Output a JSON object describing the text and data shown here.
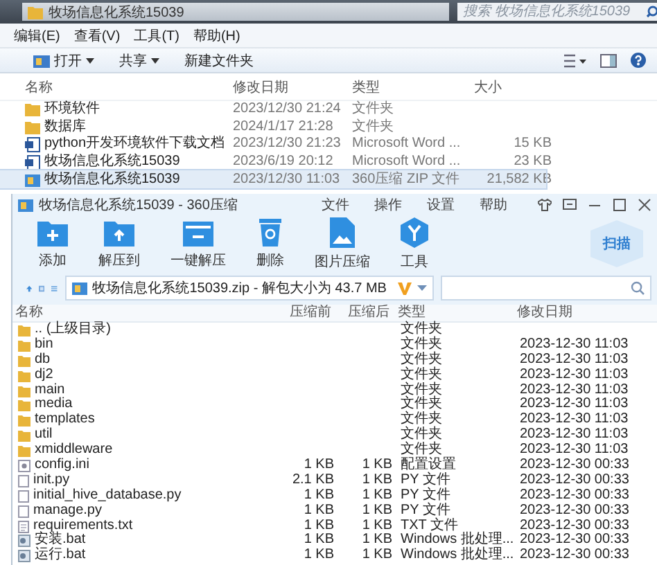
{
  "explorer": {
    "path": "牧场信息化系统15039",
    "search": {
      "placeholder": "搜索 牧场信息化系统15039"
    },
    "menu": [
      "编辑(E)",
      "查看(V)",
      "工具(T)",
      "帮助(H)"
    ],
    "toolbar": [
      {
        "label": "打开",
        "kind": "open"
      },
      {
        "label": "共享",
        "kind": "share"
      },
      {
        "label": "新建文件夹",
        "kind": "plain"
      }
    ],
    "columns": [
      "名称",
      "修改日期",
      "类型",
      "大小"
    ],
    "rows": [
      {
        "name": "环境软件",
        "date": "2023/12/30 21:24",
        "type": "文件夹",
        "size": "",
        "kind": "folder",
        "selected": false
      },
      {
        "name": "数据库",
        "date": "2024/1/17 21:28",
        "type": "文件夹",
        "size": "",
        "kind": "folder",
        "selected": false
      },
      {
        "name": "python开发环境软件下载文档",
        "date": "2023/12/30 21:23",
        "type": "Microsoft Word ...",
        "size": "15 KB",
        "kind": "word",
        "selected": false
      },
      {
        "name": "牧场信息化系统15039",
        "date": "2023/6/19 20:12",
        "type": "Microsoft Word ...",
        "size": "23 KB",
        "kind": "word",
        "selected": false
      },
      {
        "name": "牧场信息化系统15039",
        "date": "2023/12/30 11:03",
        "type": "360压缩 ZIP 文件",
        "size": "21,582 KB",
        "kind": "zip",
        "selected": true
      }
    ]
  },
  "archiver": {
    "title": "牧场信息化系统15039 - 360压缩",
    "menu": [
      "文件",
      "操作",
      "设置",
      "帮助"
    ],
    "tools": [
      {
        "label": "添加",
        "kind": "add"
      },
      {
        "label": "解压到",
        "kind": "extract"
      },
      {
        "label": "一键解压",
        "kind": "oneclick"
      },
      {
        "label": "删除",
        "kind": "delete"
      },
      {
        "label": "图片压缩",
        "kind": "image"
      },
      {
        "label": "工具",
        "kind": "tools"
      }
    ],
    "scan": "扫描",
    "address": "牧场信息化系统15039.zip - 解包大小为 43.7 MB",
    "columns": [
      "名称",
      "压缩前",
      "压缩后",
      "类型",
      "修改日期"
    ],
    "rows": [
      {
        "name": ".. (上级目录)",
        "before": "",
        "after": "",
        "type": "文件夹",
        "date": "",
        "kind": "folder"
      },
      {
        "name": "bin",
        "before": "",
        "after": "",
        "type": "文件夹",
        "date": "2023-12-30 11:03",
        "kind": "folder"
      },
      {
        "name": "db",
        "before": "",
        "after": "",
        "type": "文件夹",
        "date": "2023-12-30 11:03",
        "kind": "folder"
      },
      {
        "name": "dj2",
        "before": "",
        "after": "",
        "type": "文件夹",
        "date": "2023-12-30 11:03",
        "kind": "folder"
      },
      {
        "name": "main",
        "before": "",
        "after": "",
        "type": "文件夹",
        "date": "2023-12-30 11:03",
        "kind": "folder"
      },
      {
        "name": "media",
        "before": "",
        "after": "",
        "type": "文件夹",
        "date": "2023-12-30 11:03",
        "kind": "folder"
      },
      {
        "name": "templates",
        "before": "",
        "after": "",
        "type": "文件夹",
        "date": "2023-12-30 11:03",
        "kind": "folder"
      },
      {
        "name": "util",
        "before": "",
        "after": "",
        "type": "文件夹",
        "date": "2023-12-30 11:03",
        "kind": "folder"
      },
      {
        "name": "xmiddleware",
        "before": "",
        "after": "",
        "type": "文件夹",
        "date": "2023-12-30 11:03",
        "kind": "folder"
      },
      {
        "name": "config.ini",
        "before": "1 KB",
        "after": "1 KB",
        "type": "配置设置",
        "date": "2023-12-30 00:33",
        "kind": "settings"
      },
      {
        "name": "init.py",
        "before": "2.1 KB",
        "after": "1 KB",
        "type": "PY 文件",
        "date": "2023-12-30 00:33",
        "kind": "file"
      },
      {
        "name": "initial_hive_database.py",
        "before": "1 KB",
        "after": "1 KB",
        "type": "PY 文件",
        "date": "2023-12-30 00:33",
        "kind": "file"
      },
      {
        "name": "manage.py",
        "before": "1 KB",
        "after": "1 KB",
        "type": "PY 文件",
        "date": "2023-12-30 00:33",
        "kind": "file"
      },
      {
        "name": "requirements.txt",
        "before": "1 KB",
        "after": "1 KB",
        "type": "TXT 文件",
        "date": "2023-12-30 00:33",
        "kind": "text"
      },
      {
        "name": "安装.bat",
        "before": "1 KB",
        "after": "1 KB",
        "type": "Windows 批处理...",
        "date": "2023-12-30 00:33",
        "kind": "batch"
      },
      {
        "name": "运行.bat",
        "before": "1 KB",
        "after": "1 KB",
        "type": "Windows 批处理...",
        "date": "2023-12-30 00:33",
        "kind": "batch"
      }
    ]
  }
}
